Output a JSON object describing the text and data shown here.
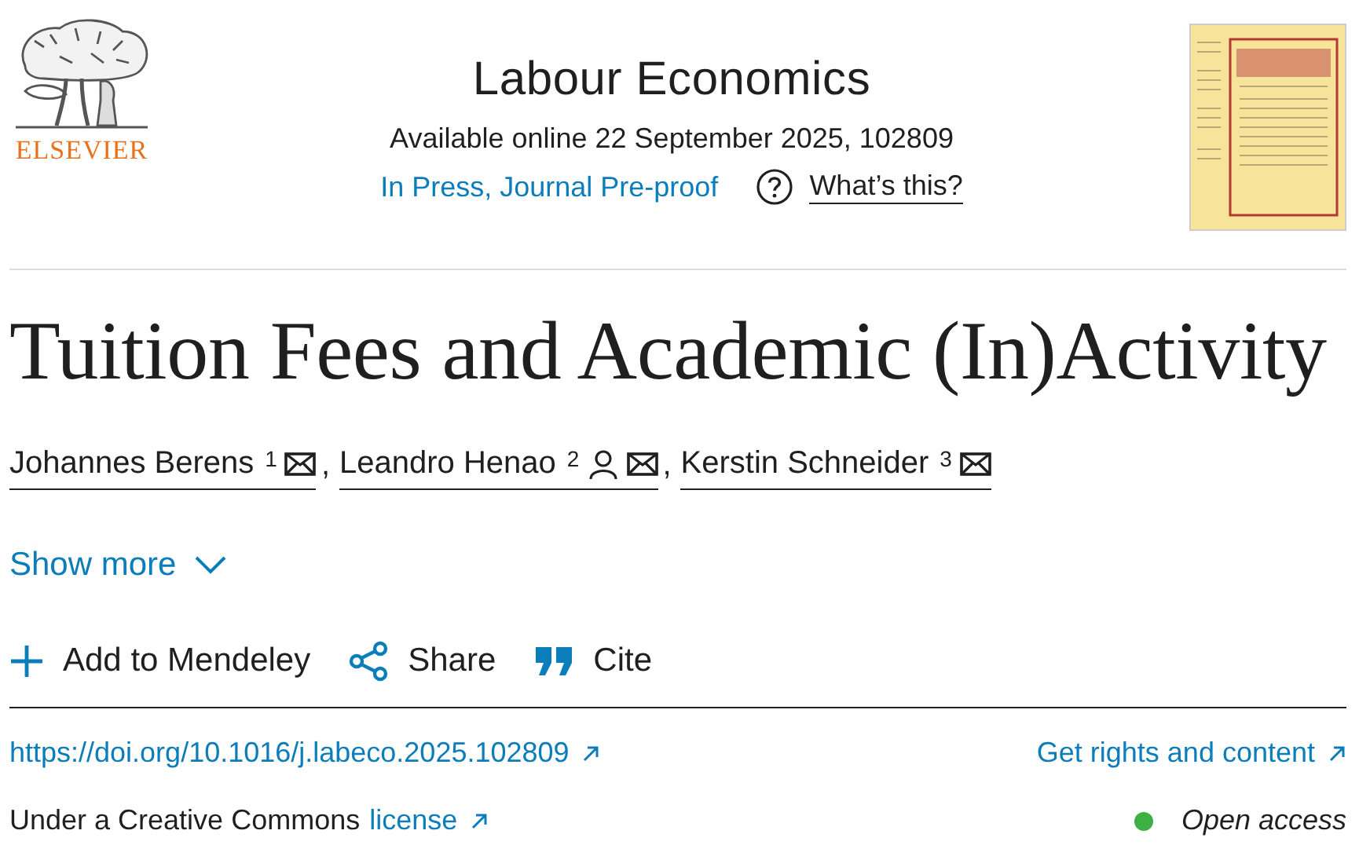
{
  "publisher": {
    "wordmark": "ELSEVIER"
  },
  "journal": {
    "name": "Labour Economics",
    "availability": "Available online 22 September 2025, 102809",
    "status": "In Press, Journal Pre-proof",
    "help_link": "What’s this?"
  },
  "article": {
    "title": "Tuition Fees and Academic (In)Activity"
  },
  "authors": [
    {
      "name": "Johannes Berens",
      "mark": "1",
      "corresponding": false
    },
    {
      "name": "Leandro Henao",
      "mark": "2",
      "corresponding": true
    },
    {
      "name": "Kerstin Schneider",
      "mark": "3",
      "corresponding": false
    }
  ],
  "author_separator": ",",
  "show_more": "Show more",
  "actions": [
    {
      "kind": "add",
      "label": "Add to Mendeley"
    },
    {
      "kind": "share",
      "label": "Share"
    },
    {
      "kind": "cite",
      "label": "Cite"
    }
  ],
  "doi": "https://doi.org/10.1016/j.labeco.2025.102809",
  "rights": "Get rights and content",
  "license": {
    "prefix": "Under a Creative Commons",
    "link": "license"
  },
  "access": {
    "label": "Open access"
  }
}
